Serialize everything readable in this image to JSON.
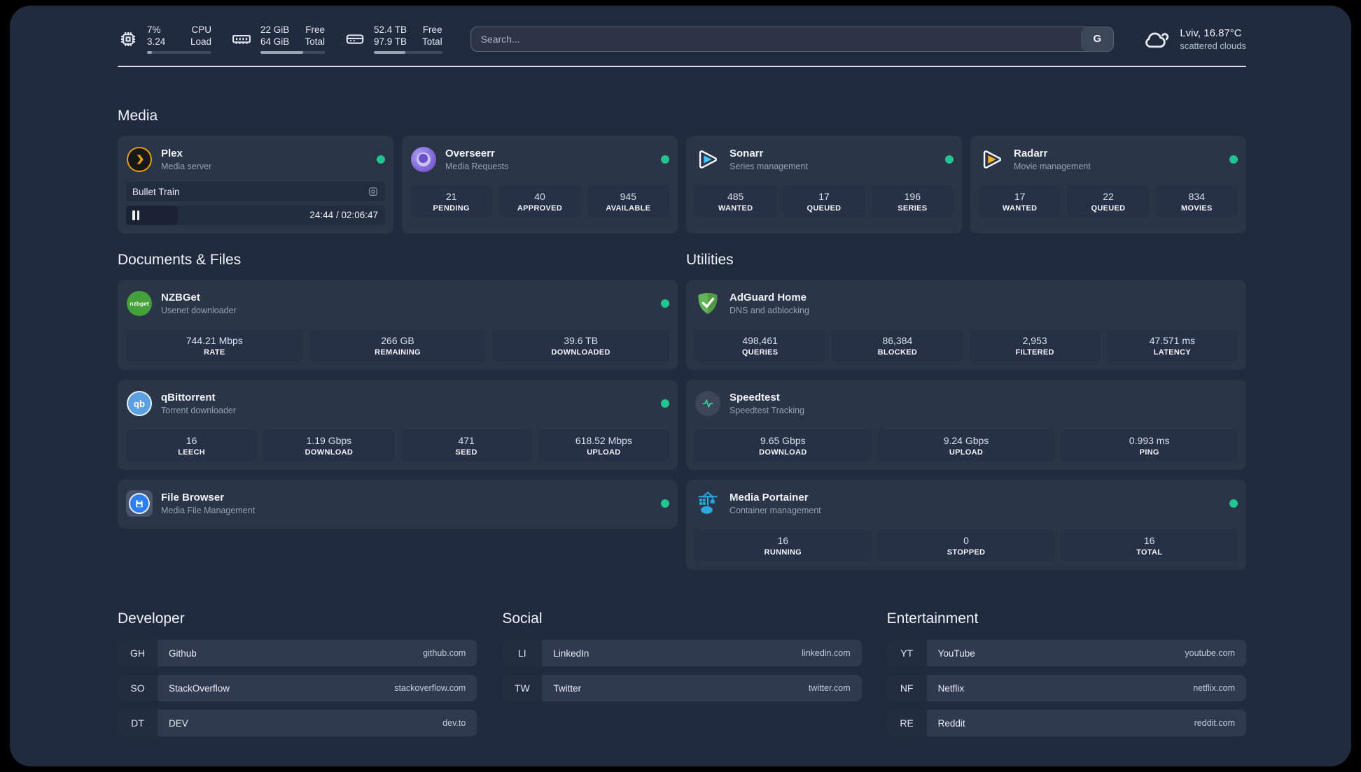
{
  "colors": {
    "status_online": "#22c38e",
    "panel_bg": "#212b3f",
    "card_bg": "#2b3548",
    "plex_accent": "#e5a00d",
    "sonarr_accent": "#3fc3f7",
    "radarr_accent": "#fdb022"
  },
  "header": {
    "system_stats": [
      {
        "icon": "cpu-icon",
        "value1": "7%",
        "value2": "3.24",
        "label1": "CPU",
        "label2": "Load",
        "progress_pct": 8
      },
      {
        "icon": "memory-icon",
        "value1": "22 GiB",
        "value2": "64 GiB",
        "label1": "Free",
        "label2": "Total",
        "progress_pct": 66
      },
      {
        "icon": "disk-icon",
        "value1": "52.4 TB",
        "value2": "97.9 TB",
        "label1": "Free",
        "label2": "Total",
        "progress_pct": 46
      }
    ],
    "search": {
      "placeholder": "Search...",
      "provider_label": "G"
    },
    "weather": {
      "icon": "cloud-icon",
      "location": "Lviv, 16.87°C",
      "condition": "scattered clouds"
    }
  },
  "sections": {
    "media": {
      "title": "Media",
      "services": [
        {
          "name": "Plex",
          "description": "Media server",
          "icon": "plex-icon",
          "online": true,
          "now_playing": {
            "title": "Bullet Train",
            "time": "24:44 / 02:06:47",
            "progress_pct": 20
          }
        },
        {
          "name": "Overseerr",
          "description": "Media Requests",
          "icon": "overseerr-icon",
          "online": true,
          "stats": [
            {
              "value": "21",
              "label": "PENDING"
            },
            {
              "value": "40",
              "label": "APPROVED"
            },
            {
              "value": "945",
              "label": "AVAILABLE"
            }
          ]
        },
        {
          "name": "Sonarr",
          "description": "Series management",
          "icon": "sonarr-icon",
          "online": true,
          "stats": [
            {
              "value": "485",
              "label": "WANTED"
            },
            {
              "value": "17",
              "label": "QUEUED"
            },
            {
              "value": "196",
              "label": "SERIES"
            }
          ]
        },
        {
          "name": "Radarr",
          "description": "Movie management",
          "icon": "radarr-icon",
          "online": true,
          "stats": [
            {
              "value": "17",
              "label": "WANTED"
            },
            {
              "value": "22",
              "label": "QUEUED"
            },
            {
              "value": "834",
              "label": "MOVIES"
            }
          ]
        }
      ]
    },
    "documents": {
      "title": "Documents & Files",
      "services": [
        {
          "name": "NZBGet",
          "description": "Usenet downloader",
          "icon": "nzbget-icon",
          "online": true,
          "stats": [
            {
              "value": "744.21 Mbps",
              "label": "RATE"
            },
            {
              "value": "266 GB",
              "label": "REMAINING"
            },
            {
              "value": "39.6 TB",
              "label": "DOWNLOADED"
            }
          ]
        },
        {
          "name": "qBittorrent",
          "description": "Torrent downloader",
          "icon": "qbittorrent-icon",
          "online": true,
          "stats": [
            {
              "value": "16",
              "label": "LEECH"
            },
            {
              "value": "1.19 Gbps",
              "label": "DOWNLOAD"
            },
            {
              "value": "471",
              "label": "SEED"
            },
            {
              "value": "618.52 Mbps",
              "label": "UPLOAD"
            }
          ]
        },
        {
          "name": "File Browser",
          "description": "Media File Management",
          "icon": "filebrowser-icon",
          "online": true,
          "stats": []
        }
      ]
    },
    "utilities": {
      "title": "Utilities",
      "services": [
        {
          "name": "AdGuard Home",
          "description": "DNS and adblocking",
          "icon": "adguard-icon",
          "stats": [
            {
              "value": "498,461",
              "label": "QUERIES"
            },
            {
              "value": "86,384",
              "label": "BLOCKED"
            },
            {
              "value": "2,953",
              "label": "FILTERED"
            },
            {
              "value": "47.571 ms",
              "label": "LATENCY"
            }
          ]
        },
        {
          "name": "Speedtest",
          "description": "Speedtest Tracking",
          "icon": "speedtest-icon",
          "stats": [
            {
              "value": "9.65 Gbps",
              "label": "DOWNLOAD"
            },
            {
              "value": "9.24 Gbps",
              "label": "UPLOAD"
            },
            {
              "value": "0.993 ms",
              "label": "PING"
            }
          ]
        },
        {
          "name": "Media Portainer",
          "description": "Container management",
          "icon": "portainer-icon",
          "online": true,
          "stats": [
            {
              "value": "16",
              "label": "RUNNING"
            },
            {
              "value": "0",
              "label": "STOPPED"
            },
            {
              "value": "16",
              "label": "TOTAL"
            }
          ]
        }
      ]
    }
  },
  "bookmarks": [
    {
      "title": "Developer",
      "links": [
        {
          "abbr": "GH",
          "name": "Github",
          "url": "github.com"
        },
        {
          "abbr": "SO",
          "name": "StackOverflow",
          "url": "stackoverflow.com"
        },
        {
          "abbr": "DT",
          "name": "DEV",
          "url": "dev.to"
        }
      ]
    },
    {
      "title": "Social",
      "links": [
        {
          "abbr": "LI",
          "name": "LinkedIn",
          "url": "linkedin.com"
        },
        {
          "abbr": "TW",
          "name": "Twitter",
          "url": "twitter.com"
        }
      ]
    },
    {
      "title": "Entertainment",
      "links": [
        {
          "abbr": "YT",
          "name": "YouTube",
          "url": "youtube.com"
        },
        {
          "abbr": "NF",
          "name": "Netflix",
          "url": "netflix.com"
        },
        {
          "abbr": "RE",
          "name": "Reddit",
          "url": "reddit.com"
        }
      ]
    }
  ]
}
